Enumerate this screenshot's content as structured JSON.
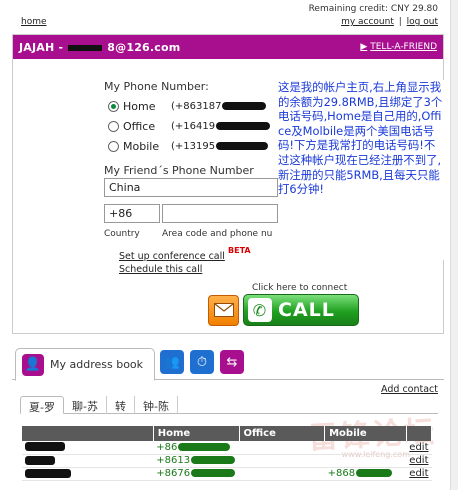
{
  "top": {
    "credit": "Remaining credit: CNY 29.80",
    "home": "home",
    "my_account": "my account",
    "separator": "|",
    "logout": "log out"
  },
  "header": {
    "user_prefix": "JAJAH -",
    "user_suffix": "8@126.com",
    "tell_friend": "TELL-A-FRIEND",
    "tell_friend_arrow": "▶"
  },
  "phones": {
    "title": "My Phone Number:",
    "items": [
      {
        "label": "Home",
        "number": "(+863187",
        "selected": true
      },
      {
        "label": "Office",
        "number": "(+16419",
        "selected": false
      },
      {
        "label": "Mobile",
        "number": "(+13195",
        "selected": false
      }
    ]
  },
  "friend": {
    "title": "My Friend´s Phone Number",
    "country_value": "China",
    "code_value": "+86",
    "country_caption": "Country",
    "area_caption": "Area code and phone nu"
  },
  "links": {
    "conference": "Set up conference call",
    "beta": "BETA",
    "schedule": "Schedule this call"
  },
  "call": {
    "hint": "Click here to connect",
    "label": "CALL",
    "email_icon": "envelope-icon",
    "phone_icon": "phone-icon"
  },
  "note": "这是我的帐户主页,右上角显示我的余额为29.8RMB,且绑定了3个电话号码,Home是自己用的,Office及Molbile是两个美国电话号码!下方是我常打的电话号码!不过这种帐户现在已经注册不到了,新注册的只能5RMB,且每天只能打6分钟!",
  "addressbook": {
    "tab_label": "My address book",
    "add_contact": "Add contact",
    "letter_tabs": [
      "夏-罗",
      "聊-苏",
      "转",
      "钟-陈"
    ],
    "columns": [
      "",
      "Home",
      "Office",
      "Mobile",
      ""
    ],
    "rows": [
      {
        "home": "+86",
        "office": "",
        "mobile": "",
        "edit": "edit"
      },
      {
        "home": "+8613",
        "office": "",
        "mobile": "",
        "edit": "edit"
      },
      {
        "home": "+8676",
        "office": "",
        "mobile": "+868",
        "edit": "edit"
      }
    ]
  },
  "watermark": {
    "title": "雷锋论坛",
    "sub": "www.leifeng.com"
  },
  "colors": {
    "brand": "#a80f8f",
    "call_green": "#20a020",
    "note_blue": "#1a39d8",
    "icon_blue": "#1f6fd0"
  }
}
